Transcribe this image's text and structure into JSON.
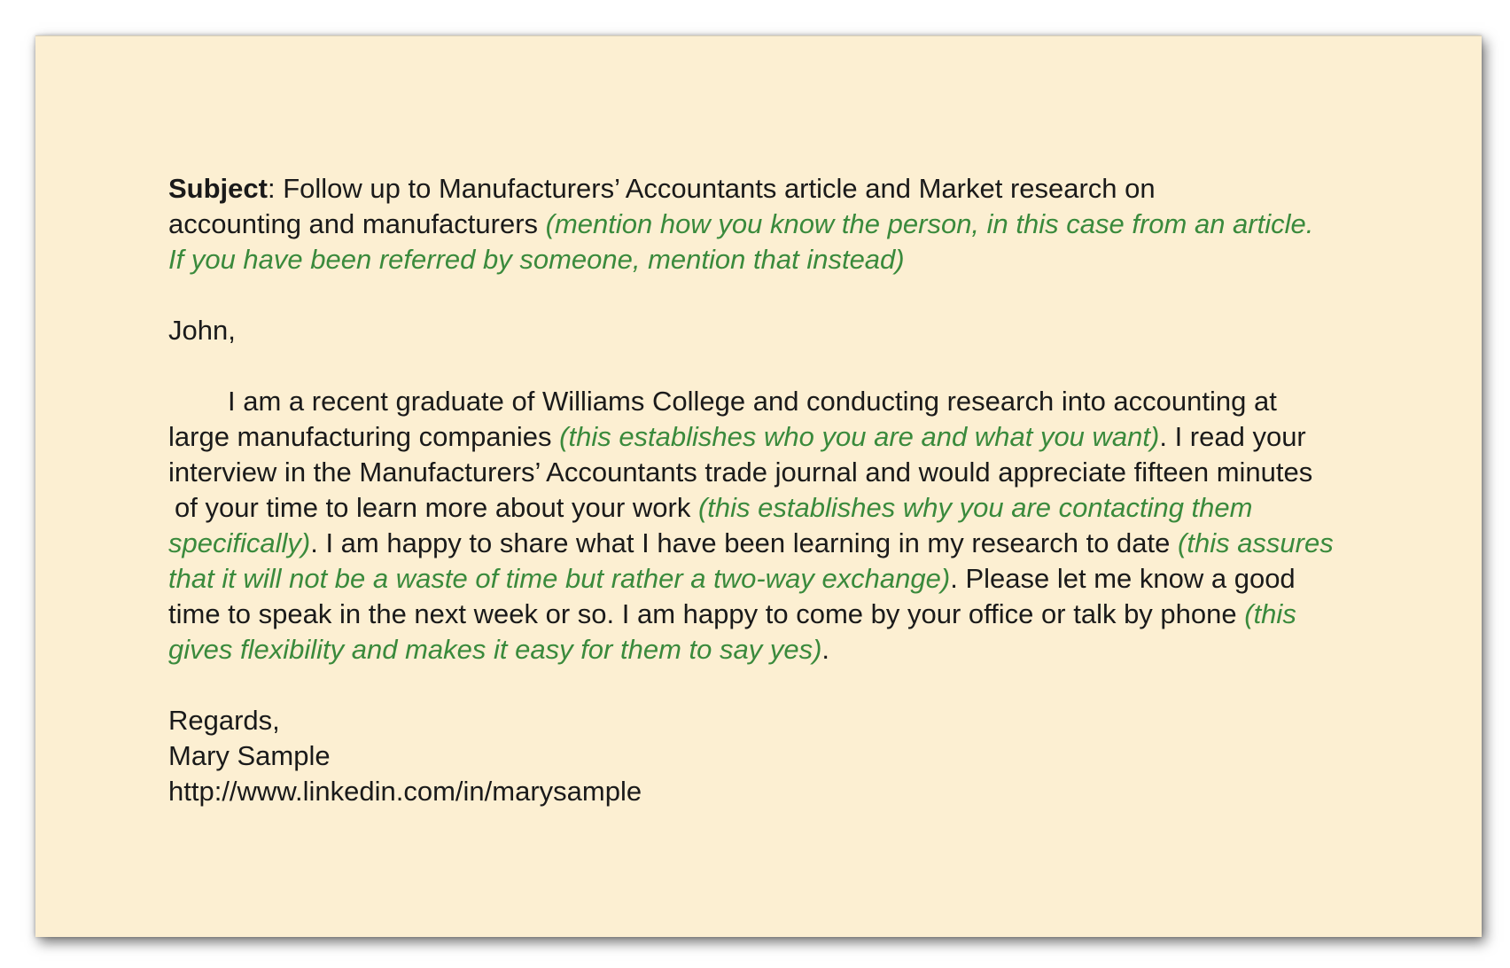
{
  "email": {
    "subject_label": "Subject",
    "subject": {
      "l1": ": Follow up to Manufacturers’ Accountants article and Market research on",
      "l2_text": "accounting and manufacturers ",
      "l2_note": "(mention how you know the person, in this case from an article.",
      "l3_note": "If you have been referred by someone, mention that instead)"
    },
    "greeting": "John,",
    "body": {
      "l1": "I am a recent graduate of Williams College and conducting research into accounting at",
      "l2_text": "large manufacturing companies ",
      "l2_note": "(this establishes who you are and what you want)",
      "l2_tail": ". I read your",
      "l3": "interview in the Manufacturers’ Accountants trade journal and would appreciate fifteen minutes",
      "l4_text": "of your time to learn more about your work ",
      "l4_note": "(this establishes why you are contacting them",
      "l5_note": "specifically)",
      "l5_text": ". I am happy to share what I have been learning in my research to date ",
      "l5_note2": "(this assures",
      "l6_note": "that it will not be a waste of time but rather a two-way exchange)",
      "l6_text": ". Please let me know a good",
      "l7_text": "time to speak in the next week or so. I am happy to come by your office or talk by phone ",
      "l7_note": "(this",
      "l8_note": "gives flexibility and makes it easy for them to say yes)",
      "l8_text": "."
    },
    "closing": "Regards,",
    "signature_name": "Mary Sample",
    "signature_url": "http://www.linkedin.com/in/marysample"
  },
  "colors": {
    "background": "#fcefd2",
    "annotation": "#3a8a3c",
    "text": "#1a1a1a"
  }
}
